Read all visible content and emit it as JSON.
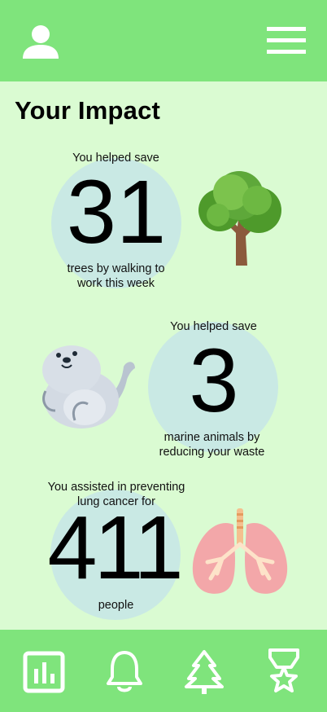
{
  "page_title": "Your Impact",
  "colors": {
    "bar": "#7fe47c",
    "background": "#dafbd2",
    "circle": "#c9e9e4",
    "icon": "#ffffff"
  },
  "header": {
    "profile_icon": "user-icon",
    "menu_icon": "hamburger-menu-icon"
  },
  "stats": [
    {
      "top_label": "You helped save",
      "value": "31",
      "bottom_label_line1": "trees by walking to",
      "bottom_label_line2": "work this week",
      "illustration": "tree-illustration"
    },
    {
      "top_label": "You helped save",
      "value": "3",
      "bottom_label_line1": "marine animals by",
      "bottom_label_line2": "reducing your waste",
      "illustration": "seal-illustration"
    },
    {
      "top_label_line1": "You assisted in preventing",
      "top_label_line2": "lung cancer for",
      "value": "411",
      "bottom_label": "people",
      "illustration": "lungs-illustration"
    }
  ],
  "nav": {
    "items": [
      "chart-icon",
      "bell-icon",
      "tree-icon",
      "award-icon"
    ]
  }
}
